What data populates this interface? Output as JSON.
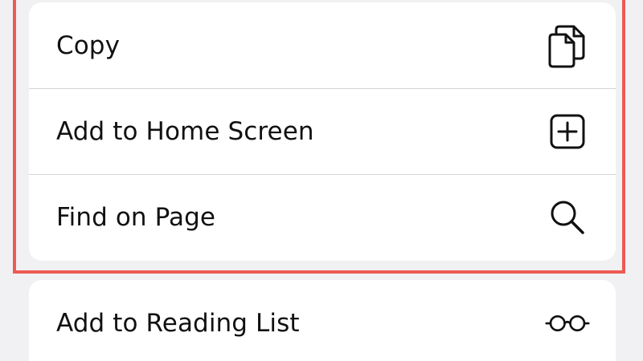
{
  "menu": {
    "primary_items": [
      {
        "label": "Copy",
        "icon": "copy-icon"
      },
      {
        "label": "Add to Home Screen",
        "icon": "add-square-icon"
      },
      {
        "label": "Find on Page",
        "icon": "magnifier-icon"
      }
    ],
    "secondary_items": [
      {
        "label": "Add to Reading List",
        "icon": "reading-glasses-icon"
      }
    ]
  },
  "colors": {
    "background": "#f1f1f3",
    "card": "#ffffff",
    "divider": "#d4d4d8",
    "highlight": "#ec5b54",
    "text": "#111111"
  }
}
